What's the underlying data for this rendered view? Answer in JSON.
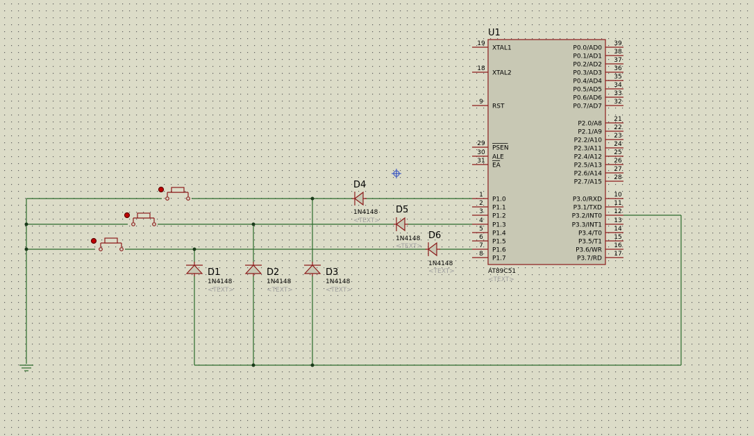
{
  "mcu": {
    "ref": "U1",
    "part": "AT89C51",
    "text_placeholder": "<TEXT>",
    "left_pins": [
      {
        "num": "19",
        "label": "XTAL1",
        "overbar": false
      },
      {
        "num": "18",
        "label": "XTAL2",
        "overbar": false
      },
      {
        "num": "9",
        "label": "RST",
        "overbar": false
      },
      {
        "num": "29",
        "label": "PSEN",
        "overbar": true
      },
      {
        "num": "30",
        "label": "ALE",
        "overbar": false
      },
      {
        "num": "31",
        "label": "EA",
        "overbar": true
      },
      {
        "num": "1",
        "label": "P1.0",
        "overbar": false
      },
      {
        "num": "2",
        "label": "P1.1",
        "overbar": false
      },
      {
        "num": "3",
        "label": "P1.2",
        "overbar": false
      },
      {
        "num": "4",
        "label": "P1.3",
        "overbar": false
      },
      {
        "num": "5",
        "label": "P1.4",
        "overbar": false
      },
      {
        "num": "6",
        "label": "P1.5",
        "overbar": false
      },
      {
        "num": "7",
        "label": "P1.6",
        "overbar": false
      },
      {
        "num": "8",
        "label": "P1.7",
        "overbar": false
      }
    ],
    "right_pins": [
      {
        "num": "39",
        "label": "P0.0/AD0"
      },
      {
        "num": "38",
        "label": "P0.1/AD1"
      },
      {
        "num": "37",
        "label": "P0.2/AD2"
      },
      {
        "num": "36",
        "label": "P0.3/AD3"
      },
      {
        "num": "35",
        "label": "P0.4/AD4"
      },
      {
        "num": "34",
        "label": "P0.5/AD5"
      },
      {
        "num": "33",
        "label": "P0.6/AD6"
      },
      {
        "num": "32",
        "label": "P0.7/AD7"
      },
      {
        "num": "21",
        "label": "P2.0/A8"
      },
      {
        "num": "22",
        "label": "P2.1/A9"
      },
      {
        "num": "23",
        "label": "P2.2/A10"
      },
      {
        "num": "24",
        "label": "P2.3/A11"
      },
      {
        "num": "25",
        "label": "P2.4/A12"
      },
      {
        "num": "26",
        "label": "P2.5/A13"
      },
      {
        "num": "27",
        "label": "P2.6/A14"
      },
      {
        "num": "28",
        "label": "P2.7/A15"
      },
      {
        "num": "10",
        "label": "P3.0/RXD"
      },
      {
        "num": "11",
        "label": "P3.1/TXD"
      },
      {
        "num": "12",
        "label": "P3.2/INT0"
      },
      {
        "num": "13",
        "label": "P3.3/INT1"
      },
      {
        "num": "14",
        "label": "P3.4/T0"
      },
      {
        "num": "15",
        "label": "P3.5/T1"
      },
      {
        "num": "16",
        "label": "P3.6/WR"
      },
      {
        "num": "17",
        "label": "P3.7/RD"
      }
    ]
  },
  "diodes": [
    {
      "ref": "D1",
      "value": "1N4148",
      "text": "<TEXT>"
    },
    {
      "ref": "D2",
      "value": "1N4148",
      "text": "<TEXT>"
    },
    {
      "ref": "D3",
      "value": "1N4148",
      "text": "<TEXT>"
    },
    {
      "ref": "D4",
      "value": "1N4148",
      "text": "<TEXT>"
    },
    {
      "ref": "D5",
      "value": "1N4148",
      "text": "<TEXT>"
    },
    {
      "ref": "D6",
      "value": "1N4148",
      "text": "<TEXT>"
    }
  ],
  "colors": {
    "background": "#dcdcc8",
    "grid_dot": "#5a5a5a",
    "wire": "#2a6a2a",
    "component": "#8b1a1a",
    "chip_fill": "#c8c8b4",
    "junction": "#1a3a1a",
    "switch_pin": "#c00000",
    "cursor": "#2040c0"
  }
}
